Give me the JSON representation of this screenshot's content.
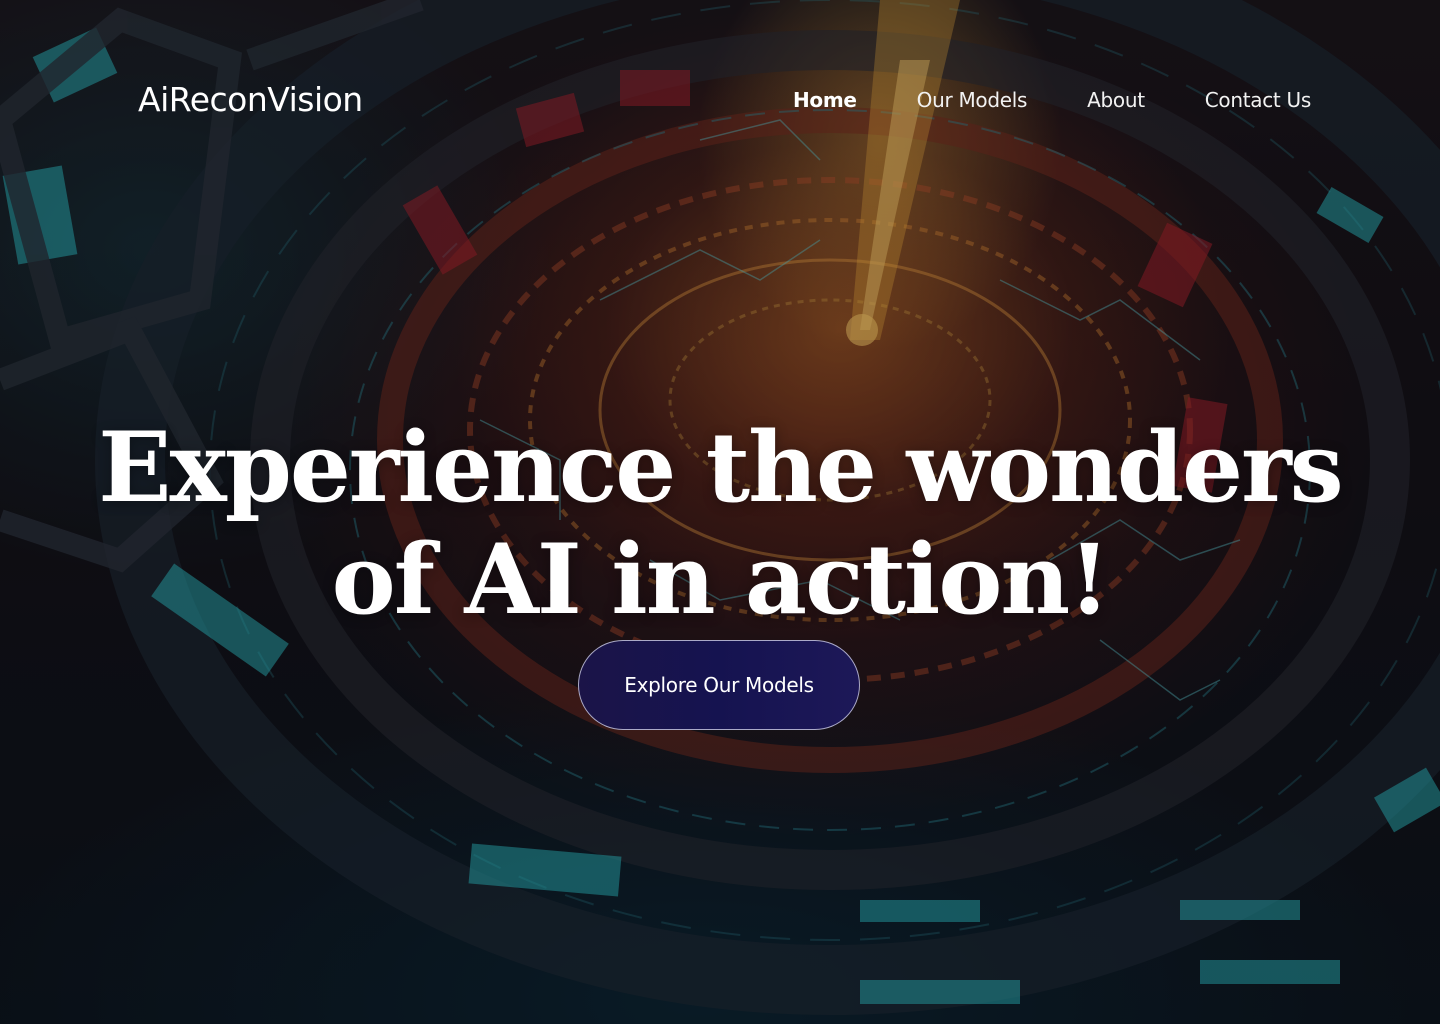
{
  "brand": {
    "name": "AiReconVision"
  },
  "nav": {
    "items": [
      {
        "label": "Home",
        "active": true
      },
      {
        "label": "Our Models",
        "active": false
      },
      {
        "label": "About",
        "active": false
      },
      {
        "label": "Contact Us",
        "active": false
      }
    ]
  },
  "hero": {
    "headline_line1": "Experience the wonders",
    "headline_line2": "of AI in action!",
    "cta_label": "Explore Our Models",
    "background": "futuristic-circuit-reactor-image"
  },
  "colors": {
    "text": "#ffffff",
    "cta_bg": "#16134e",
    "cta_border": "#dcdcf0",
    "accent_orange": "#e07a2a",
    "accent_teal": "#2ec4c9"
  }
}
